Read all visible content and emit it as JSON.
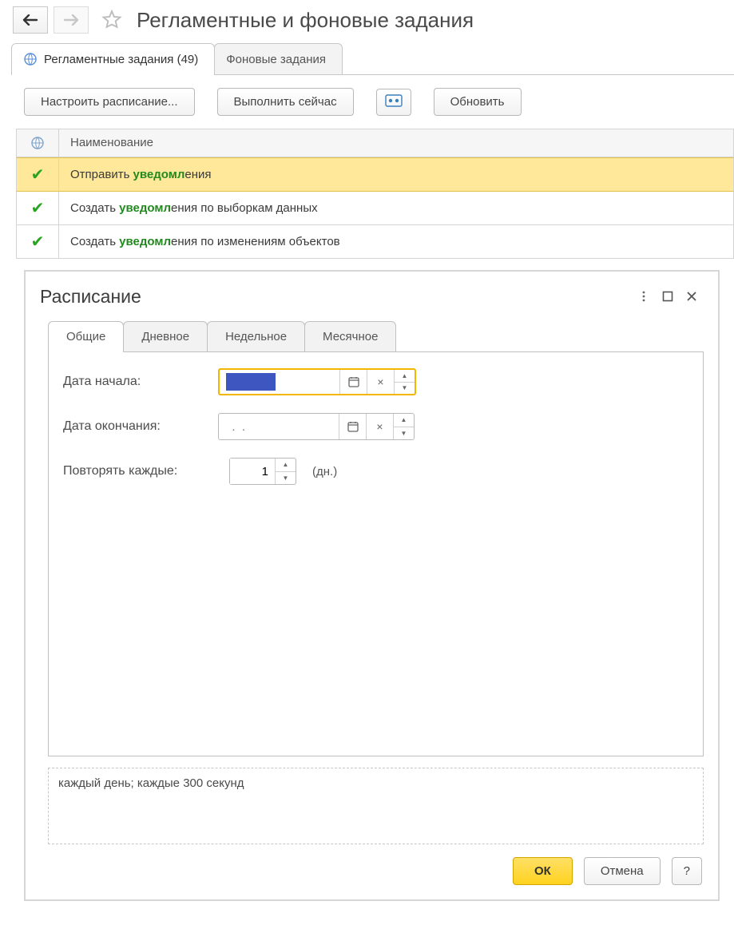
{
  "header": {
    "title": "Регламентные и фоновые задания"
  },
  "outer_tabs": {
    "scheduled": "Регламентные задания (49)",
    "background": "Фоновые задания"
  },
  "toolbar": {
    "configure": "Настроить расписание...",
    "run_now": "Выполнить сейчас",
    "refresh": "Обновить"
  },
  "grid": {
    "header_name": "Наименование",
    "rows": [
      {
        "pre": "Отправить ",
        "hl": "уведомл",
        "post": "ения",
        "selected": true
      },
      {
        "pre": "Создать ",
        "hl": "уведомл",
        "post": "ения по выборкам данных",
        "selected": false
      },
      {
        "pre": "Создать ",
        "hl": "уведомл",
        "post": "ения по изменениям объектов",
        "selected": false
      }
    ]
  },
  "modal": {
    "title": "Расписание",
    "inner_tabs": {
      "common": "Общие",
      "daily": "Дневное",
      "weekly": "Недельное",
      "monthly": "Месячное"
    },
    "form": {
      "start_label": "Дата начала:",
      "end_label": "Дата окончания:",
      "end_value": "  .  .    ",
      "repeat_label": "Повторять каждые:",
      "repeat_value": "1",
      "repeat_unit": "(дн.)"
    },
    "summary": "каждый день; каждые 300 секунд",
    "footer": {
      "ok": "ОК",
      "cancel": "Отмена",
      "help": "?"
    }
  }
}
